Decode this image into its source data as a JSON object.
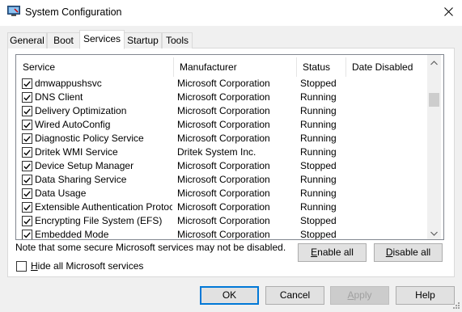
{
  "window": {
    "title": "System Configuration",
    "close_symbol": "✕"
  },
  "tabs": [
    "General",
    "Boot",
    "Services",
    "Startup",
    "Tools"
  ],
  "active_tab": "Services",
  "columns": {
    "service": "Service",
    "manufacturer": "Manufacturer",
    "status": "Status",
    "date_disabled": "Date Disabled"
  },
  "services": [
    {
      "name": "dmwappushsvc",
      "manufacturer": "Microsoft Corporation",
      "status": "Stopped",
      "date_disabled": "",
      "checked": true
    },
    {
      "name": "DNS Client",
      "manufacturer": "Microsoft Corporation",
      "status": "Running",
      "date_disabled": "",
      "checked": true
    },
    {
      "name": "Delivery Optimization",
      "manufacturer": "Microsoft Corporation",
      "status": "Running",
      "date_disabled": "",
      "checked": true
    },
    {
      "name": "Wired AutoConfig",
      "manufacturer": "Microsoft Corporation",
      "status": "Running",
      "date_disabled": "",
      "checked": true
    },
    {
      "name": "Diagnostic Policy Service",
      "manufacturer": "Microsoft Corporation",
      "status": "Running",
      "date_disabled": "",
      "checked": true
    },
    {
      "name": "Dritek WMI Service",
      "manufacturer": "Dritek System Inc.",
      "status": "Running",
      "date_disabled": "",
      "checked": true
    },
    {
      "name": "Device Setup Manager",
      "manufacturer": "Microsoft Corporation",
      "status": "Stopped",
      "date_disabled": "",
      "checked": true
    },
    {
      "name": "Data Sharing Service",
      "manufacturer": "Microsoft Corporation",
      "status": "Running",
      "date_disabled": "",
      "checked": true
    },
    {
      "name": "Data Usage",
      "manufacturer": "Microsoft Corporation",
      "status": "Running",
      "date_disabled": "",
      "checked": true
    },
    {
      "name": "Extensible Authentication Protocol",
      "manufacturer": "Microsoft Corporation",
      "status": "Running",
      "date_disabled": "",
      "checked": true
    },
    {
      "name": "Encrypting File System (EFS)",
      "manufacturer": "Microsoft Corporation",
      "status": "Stopped",
      "date_disabled": "",
      "checked": true
    },
    {
      "name": "Embedded Mode",
      "manufacturer": "Microsoft Corporation",
      "status": "Stopped",
      "date_disabled": "",
      "checked": true
    }
  ],
  "note": "Note that some secure Microsoft services may not be disabled.",
  "buttons": {
    "enable_all": {
      "pre": "",
      "key": "E",
      "post": "nable all"
    },
    "disable_all": {
      "pre": "",
      "key": "D",
      "post": "isable all"
    },
    "ok": "OK",
    "cancel": "Cancel",
    "apply": {
      "pre": "",
      "key": "A",
      "post": "pply"
    },
    "help": "Help"
  },
  "hide_ms": {
    "pre": "",
    "key": "H",
    "post": "ide all Microsoft services",
    "checked": false
  },
  "icons": {
    "app": "system-config-icon",
    "close": "close-icon",
    "check": "checkmark-icon",
    "scroll_up": "chevron-up-icon",
    "scroll_down": "chevron-down-icon",
    "grip": "resize-grip-icon"
  },
  "colors": {
    "window_bg": "#f0f0f0",
    "panel_bg": "#ffffff",
    "button_bg": "#e1e1e1",
    "focus_border": "#0078d7",
    "disabled_text": "#a0a0a0"
  }
}
